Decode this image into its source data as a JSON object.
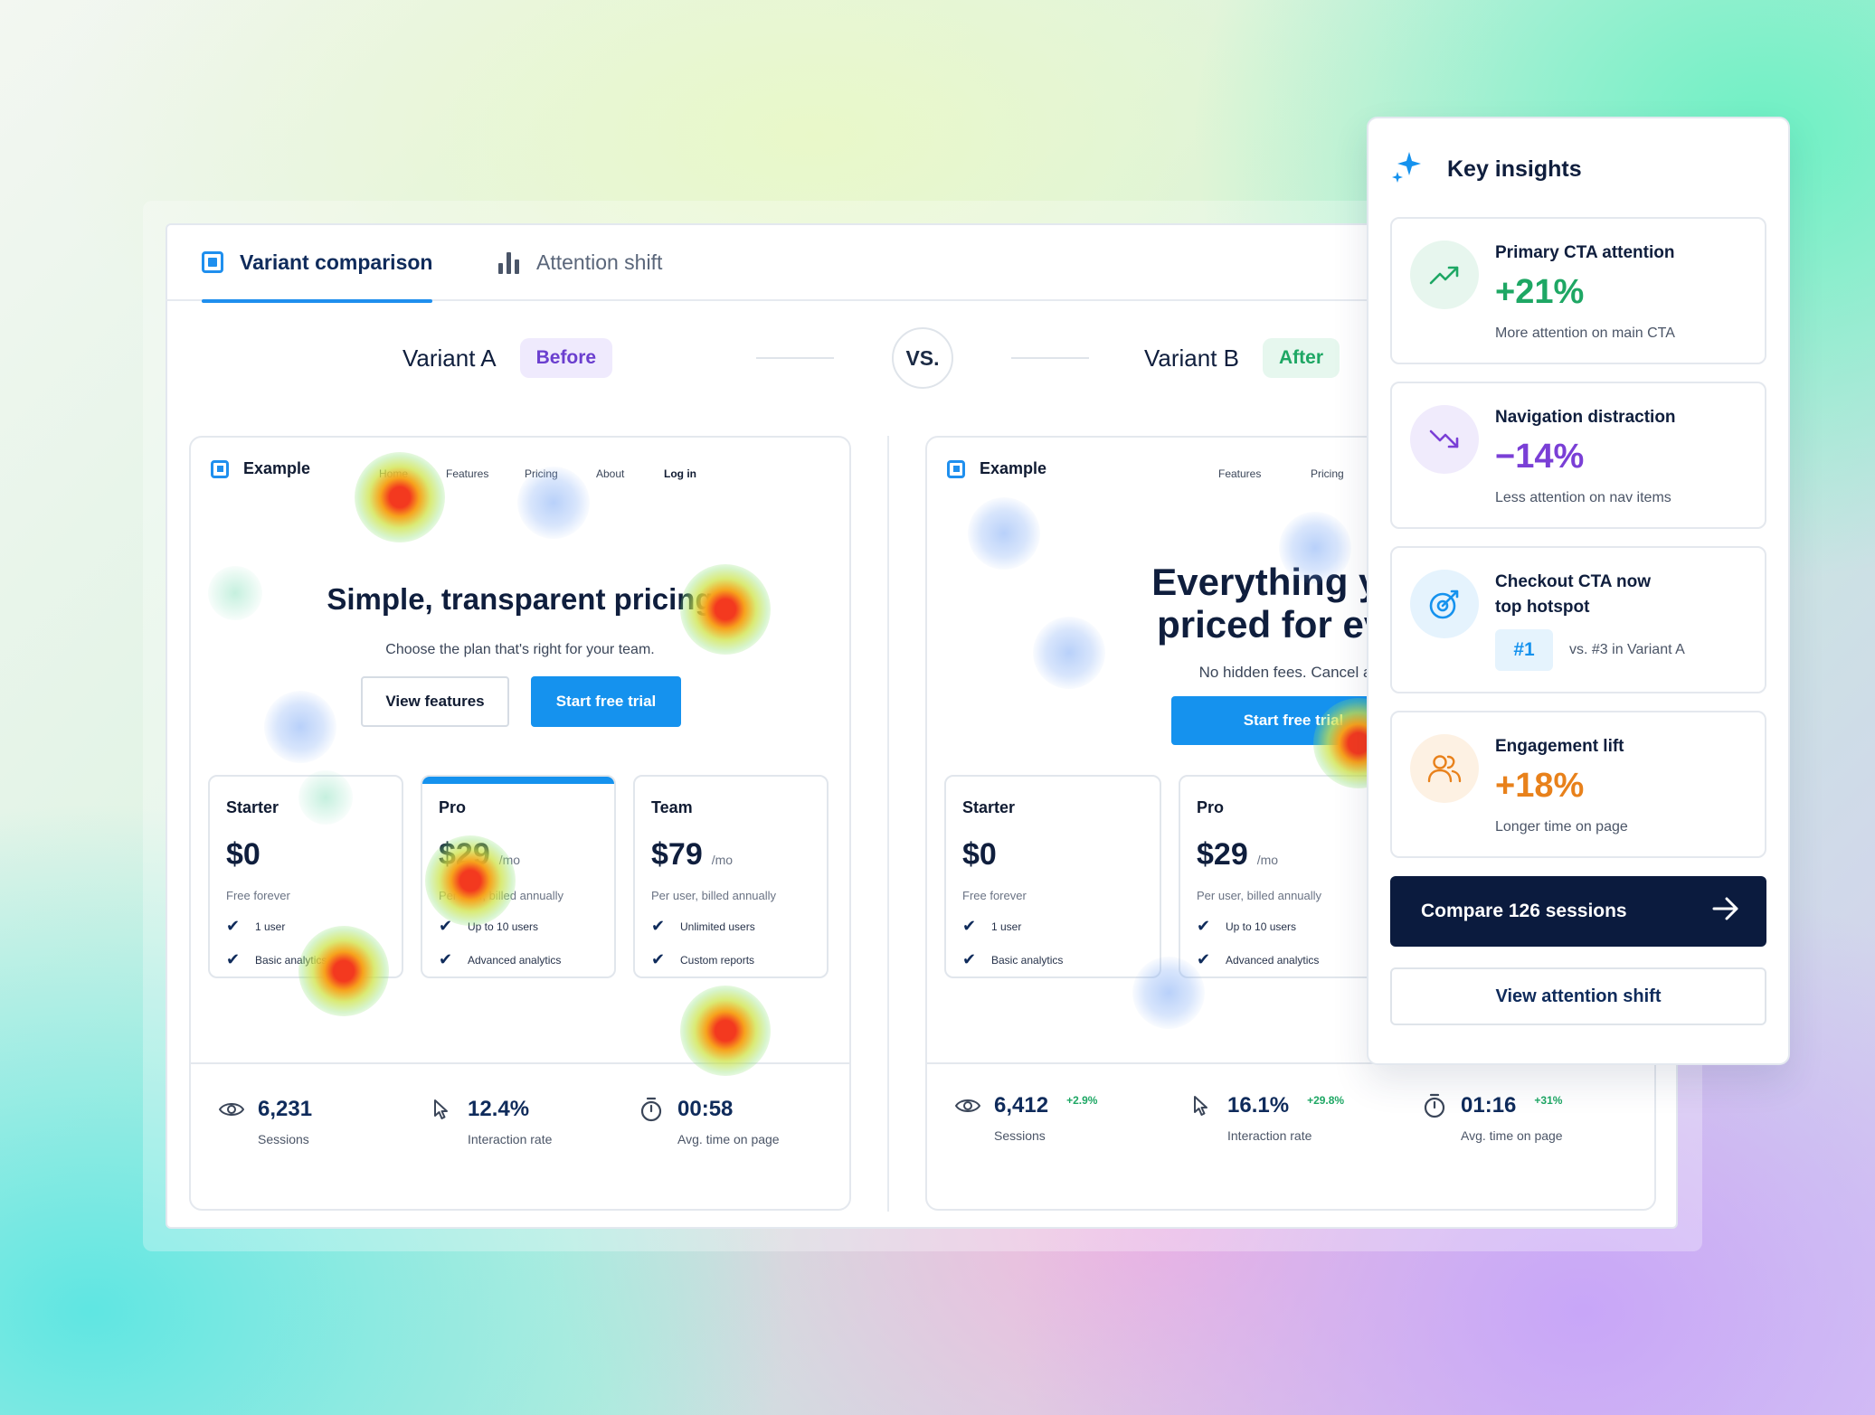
{
  "tabs": {
    "variant_comparison": "Variant comparison",
    "attention_shift": "Attention shift"
  },
  "variants": {
    "a_label": "Variant A",
    "a_pill": "Before",
    "vs": "VS.",
    "b_label": "Variant B",
    "b_pill": "After"
  },
  "site": {
    "brand": "Example",
    "nav_a": [
      "Home",
      "Features",
      "Pricing",
      "About",
      "Log in"
    ],
    "nav_b": [
      "Features",
      "Pricing"
    ]
  },
  "variant_a": {
    "hero_title": "Simple, transparent pricing",
    "hero_sub": "Choose the plan that's right for your team.",
    "btn_secondary": "View features",
    "btn_primary": "Start free trial",
    "plans": [
      {
        "name": "Starter",
        "price": "$0",
        "per": "",
        "note": "Free forever",
        "features": [
          "1 user",
          "Basic analytics"
        ]
      },
      {
        "name": "Pro",
        "price": "$29",
        "per": "/mo",
        "note": "Per user, billed annually",
        "features": [
          "Up to 10 users",
          "Advanced analytics"
        ]
      },
      {
        "name": "Team",
        "price": "$79",
        "per": "/mo",
        "note": "Per user, billed annually",
        "features": [
          "Unlimited users",
          "Custom reports"
        ]
      }
    ],
    "stats": [
      {
        "value": "6,231",
        "label": "Sessions"
      },
      {
        "value": "12.4%",
        "label": "Interaction rate"
      },
      {
        "value": "00:58",
        "label": "Avg. time on page"
      }
    ]
  },
  "variant_b": {
    "hero_title_1": "Everything you",
    "hero_title_2": "priced for ever",
    "hero_sub": "No hidden fees. Cancel any",
    "btn_primary": "Start free trial",
    "plans": [
      {
        "name": "Starter",
        "price": "$0",
        "per": "",
        "note": "Free forever",
        "features": [
          "1 user",
          "Basic analytics"
        ]
      },
      {
        "name": "Pro",
        "price": "$29",
        "per": "/mo",
        "note": "Per user, billed annually",
        "features": [
          "Up to 10 users",
          "Advanced analytics"
        ]
      }
    ],
    "stats": [
      {
        "value": "6,412",
        "delta": "+2.9%",
        "label": "Sessions"
      },
      {
        "value": "16.1%",
        "delta": "+29.8%",
        "label": "Interaction rate"
      },
      {
        "value": "01:16",
        "delta": "+31%",
        "label": "Avg. time on page"
      }
    ]
  },
  "insights": {
    "title": "Key insights",
    "cards": [
      {
        "title": "Primary CTA attention",
        "value": "+21%",
        "sub": "More attention on main CTA",
        "color": "#1ea764",
        "icon": "trend-up-icon"
      },
      {
        "title": "Navigation distraction",
        "value": "−14%",
        "sub": "Less attention on nav items",
        "color": "#7a3fd6",
        "icon": "trend-down-icon"
      },
      {
        "title": "Checkout CTA now top hotspot",
        "rank": "#1",
        "sub": "vs. #3 in Variant A",
        "color": "#1592ee",
        "icon": "target-icon"
      },
      {
        "title": "Engagement lift",
        "value": "+18%",
        "sub": "Longer time on page",
        "color": "#e8811b",
        "icon": "users-icon"
      }
    ],
    "cta_primary": "Compare 126 sessions",
    "cta_secondary": "View attention shift"
  },
  "colors": {
    "accent": "#1592ee",
    "navy": "#0b1b3e",
    "positive": "#1ea764",
    "purple": "#7a3fd6",
    "orange": "#e8811b"
  }
}
